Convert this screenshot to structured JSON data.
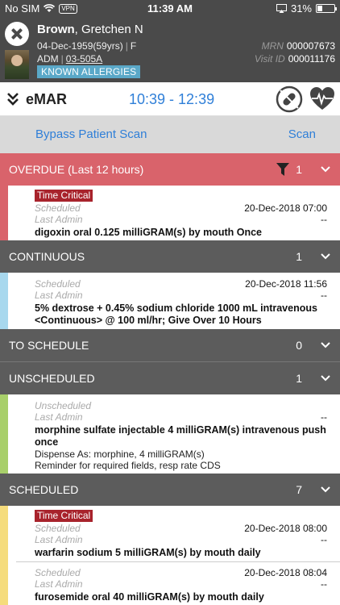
{
  "status_bar": {
    "carrier": "No SIM",
    "vpn": "VPN",
    "time": "11:39 AM",
    "battery": "31%",
    "battery_level": 0.31
  },
  "patient": {
    "last_name": "Brown",
    "first_name": ", Gretchen N",
    "dob": "04-Dec-1959",
    "age": "(59yrs)",
    "sex": "F",
    "admission": "ADM",
    "room": "03-505A",
    "allergy_badge": "KNOWN ALLERGIES",
    "mrn_label": "MRN",
    "mrn": "000007673",
    "visit_label": "Visit ID",
    "visit_id": "000011176"
  },
  "emar": {
    "title": "eMAR",
    "time_range": "10:39 - 12:39"
  },
  "scan": {
    "bypass": "Bypass Patient Scan",
    "scan": "Scan"
  },
  "sections": {
    "overdue": {
      "title": "OVERDUE (Last 12 hours)",
      "count": "1"
    },
    "continuous": {
      "title": "CONTINUOUS",
      "count": "1"
    },
    "to_schedule": {
      "title": "TO SCHEDULE",
      "count": "0"
    },
    "unscheduled": {
      "title": "UNSCHEDULED",
      "count": "1"
    },
    "scheduled": {
      "title": "SCHEDULED",
      "count": "7"
    }
  },
  "meds": {
    "overdue_1": {
      "badge": "Time Critical",
      "scheduled_label": "Scheduled",
      "scheduled": "20-Dec-2018 07:00",
      "last_label": "Last Admin",
      "last": "--",
      "drug": "digoxin   oral 0.125 milliGRAM(s)  by mouth  Once"
    },
    "continuous_1": {
      "scheduled_label": "Scheduled",
      "scheduled": "20-Dec-2018 11:56",
      "last_label": "Last Admin",
      "last": "--",
      "drug": "5% dextrose + 0.45% sodium chloride 1000 mL intravenous <Continuous> @ 100 ml/hr; Give Over 10 Hours"
    },
    "unscheduled_1": {
      "scheduled_label": "Unscheduled",
      "last_label": "Last Admin",
      "last": "--",
      "drug": "morphine sulfate injectable 4 milliGRAM(s) intravenous push once",
      "note1": "Dispense As: morphine, 4 milliGRAM(s)",
      "note2": "Reminder for required fields, resp rate CDS"
    },
    "scheduled_1": {
      "badge": "Time Critical",
      "scheduled_label": "Scheduled",
      "scheduled": "20-Dec-2018 08:00",
      "last_label": "Last Admin",
      "last": "--",
      "drug": "warfarin sodium 5 milliGRAM(s) by mouth daily"
    },
    "scheduled_2": {
      "scheduled_label": "Scheduled",
      "scheduled": "20-Dec-2018 08:04",
      "last_label": "Last Admin",
      "last": "--",
      "drug": "furosemide oral 40 milliGRAM(s)  by mouth  daily"
    }
  },
  "colors": {
    "overdue_header": "#d9636b",
    "section_header": "#5c5c5c",
    "time_critical": "#a8232c",
    "accent_blue": "#2f7fd8",
    "stripe_overdue": "#d9636b",
    "stripe_continuous": "#a8d8ee",
    "stripe_unscheduled": "#a8cf6a",
    "stripe_scheduled": "#f5dc7c"
  }
}
